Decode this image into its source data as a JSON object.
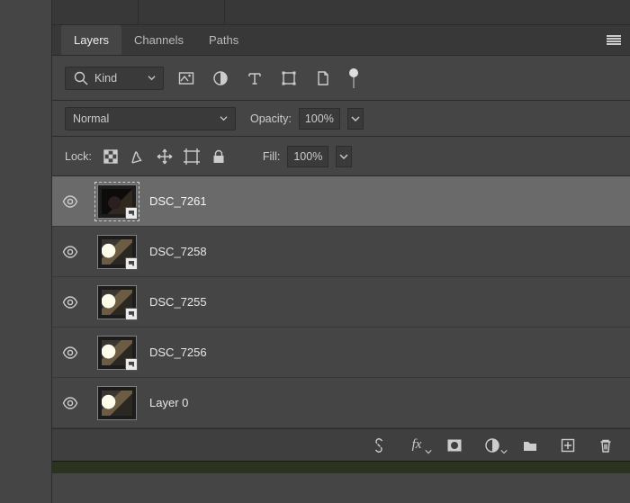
{
  "tabs": {
    "layers": "Layers",
    "channels": "Channels",
    "paths": "Paths"
  },
  "filter": {
    "kind_label": "Kind"
  },
  "blend": {
    "mode": "Normal",
    "opacity_label": "Opacity:",
    "opacity_value": "100%"
  },
  "lock": {
    "label": "Lock:",
    "fill_label": "Fill:",
    "fill_value": "100%"
  },
  "layers": [
    {
      "name": "DSC_7261",
      "selected": true,
      "smart": true,
      "dark": true
    },
    {
      "name": "DSC_7258",
      "selected": false,
      "smart": true,
      "dark": false
    },
    {
      "name": "DSC_7255",
      "selected": false,
      "smart": true,
      "dark": false
    },
    {
      "name": "DSC_7256",
      "selected": false,
      "smart": true,
      "dark": false
    },
    {
      "name": "Layer 0",
      "selected": false,
      "smart": false,
      "dark": false
    }
  ]
}
